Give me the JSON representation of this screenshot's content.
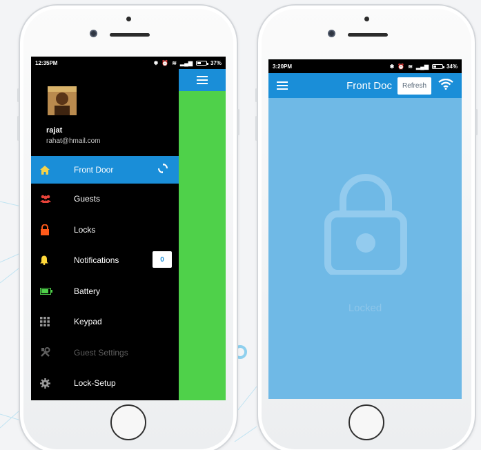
{
  "left_phone": {
    "status": {
      "time": "12:35PM",
      "battery": "37%",
      "battery_level": 0.37
    },
    "user": {
      "name": "rajat",
      "email": "rahat@hmail.com"
    },
    "menu": [
      {
        "label": "Front Door",
        "icon": "home-icon",
        "active": true,
        "trailing": "sync-icon"
      },
      {
        "label": "Guests",
        "icon": "guests-icon"
      },
      {
        "label": "Locks",
        "icon": "lock-icon"
      },
      {
        "label": "Notifications",
        "icon": "bell-icon",
        "badge": "0"
      },
      {
        "label": "Battery",
        "icon": "battery-icon"
      },
      {
        "label": "Keypad",
        "icon": "keypad-icon"
      },
      {
        "label": "Guest Settings",
        "icon": "tools-icon",
        "disabled": true
      },
      {
        "label": "Lock-Setup",
        "icon": "gear-icon"
      }
    ]
  },
  "right_phone": {
    "status": {
      "time": "3:20PM",
      "battery": "34%",
      "battery_level": 0.34
    },
    "title": "Front Doc",
    "refresh_label": "Refresh",
    "lock_state": "Locked"
  },
  "colors": {
    "accent_blue": "#1a8ed8",
    "drawer_bg": "#000000",
    "green_content": "#4fd14a",
    "lock_bg": "#6fb9e6"
  }
}
